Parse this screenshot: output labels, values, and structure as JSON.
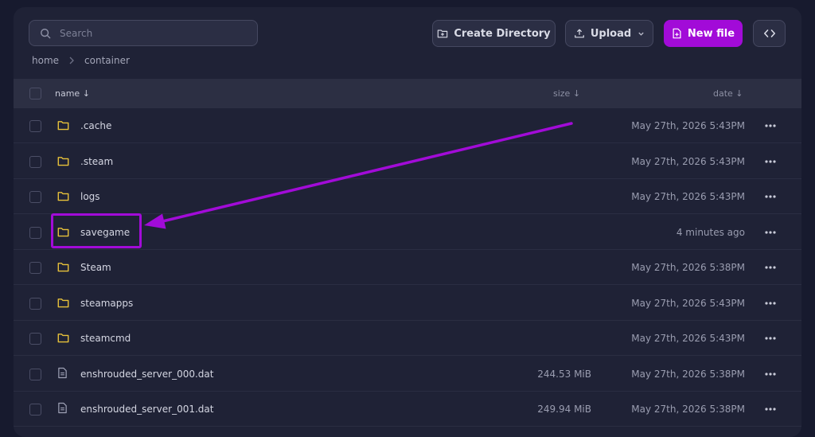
{
  "search": {
    "placeholder": "Search"
  },
  "toolbar": {
    "create_directory_label": "Create Directory",
    "upload_label": "Upload",
    "new_file_label": "New file"
  },
  "breadcrumb": [
    "home",
    "container"
  ],
  "table": {
    "headers": {
      "name": "name ↓",
      "size": "size ↓",
      "date": "date ↓"
    },
    "rows": [
      {
        "name": ".cache",
        "type": "folder",
        "size": "",
        "date": "May 27th, 2026 5:43PM"
      },
      {
        "name": ".steam",
        "type": "folder",
        "size": "",
        "date": "May 27th, 2026 5:43PM"
      },
      {
        "name": "logs",
        "type": "folder",
        "size": "",
        "date": "May 27th, 2026 5:43PM"
      },
      {
        "name": "savegame",
        "type": "folder",
        "size": "",
        "date": "4 minutes ago"
      },
      {
        "name": "Steam",
        "type": "folder",
        "size": "",
        "date": "May 27th, 2026 5:38PM"
      },
      {
        "name": "steamapps",
        "type": "folder",
        "size": "",
        "date": "May 27th, 2026 5:43PM"
      },
      {
        "name": "steamcmd",
        "type": "folder",
        "size": "",
        "date": "May 27th, 2026 5:43PM"
      },
      {
        "name": "enshrouded_server_000.dat",
        "type": "file",
        "size": "244.53 MiB",
        "date": "May 27th, 2026 5:38PM"
      },
      {
        "name": "enshrouded_server_001.dat",
        "type": "file",
        "size": "249.94 MiB",
        "date": "May 27th, 2026 5:38PM"
      }
    ]
  },
  "colors": {
    "accent": "#a20bd8",
    "folder_icon": "#e8c23a",
    "background": "#171a2e",
    "panel": "#1f2236"
  },
  "icons": {
    "search": "search-icon",
    "folder": "folder-icon",
    "file": "file-icon",
    "more": "more-options-icon",
    "upload": "upload-icon",
    "new_file": "file-plus-icon",
    "create_directory": "folder-plus-icon",
    "code": "code-icon"
  }
}
